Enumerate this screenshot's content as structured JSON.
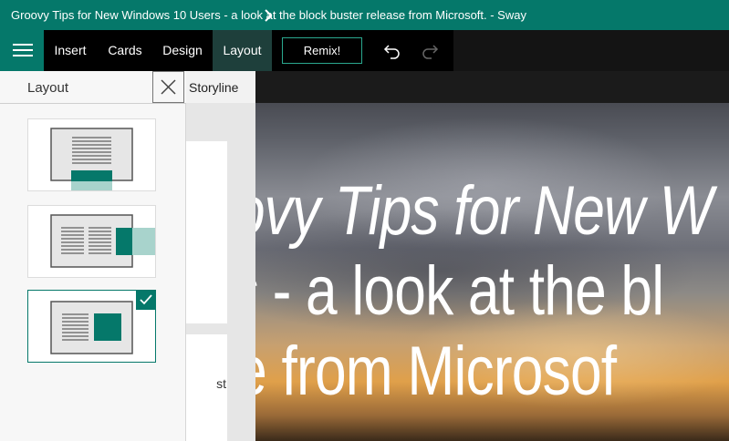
{
  "window": {
    "title": "Groovy Tips for New Windows 10 Users - a look at the block buster release from Microsoft. - Sway"
  },
  "toolbar": {
    "menu_items": [
      {
        "label": "Insert"
      },
      {
        "label": "Cards"
      },
      {
        "label": "Design"
      },
      {
        "label": "Layout",
        "active": true
      }
    ],
    "remix_label": "Remix!",
    "icons": [
      "hamburger-icon",
      "undo-icon",
      "redo-icon"
    ]
  },
  "tabs": {
    "storyline_label": "Storyline"
  },
  "layout_panel": {
    "title": "Layout",
    "options": [
      {
        "type": "vertical",
        "selected": false
      },
      {
        "type": "horizontal",
        "selected": false
      },
      {
        "type": "presentation",
        "selected": true
      }
    ]
  },
  "storyline": {
    "visible_text": "st"
  },
  "canvas": {
    "title_lines": [
      {
        "italic": "oovy Tips for New W",
        "regular": ""
      },
      {
        "italic": "ers",
        "regular": " - a look at the bl"
      },
      {
        "italic": "",
        "regular": "ase from Microsof"
      }
    ]
  },
  "colors": {
    "accent": "#05786a",
    "toolbar": "#000000",
    "panel_bg": "#f7f7f7"
  }
}
